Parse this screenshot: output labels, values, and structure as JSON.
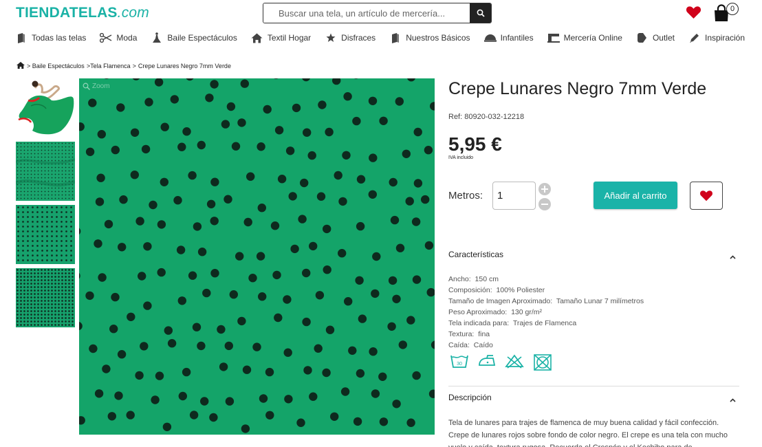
{
  "header": {
    "logo_main": "TIENDATELAS",
    "logo_domain": ".com",
    "search_placeholder": "Buscar una tela, un artículo de mercería...",
    "cart_count": "0"
  },
  "nav": [
    {
      "label": "Todas las telas",
      "icon": "fabric-roll-icon"
    },
    {
      "label": "Moda",
      "icon": "scissors-icon"
    },
    {
      "label": "Baile Espectáculos",
      "icon": "dancer-icon"
    },
    {
      "label": "Textil Hogar",
      "icon": "house-icon"
    },
    {
      "label": "Disfraces",
      "icon": "star-icon"
    },
    {
      "label": "Nuestros Básicos",
      "icon": "fabric-roll-icon"
    },
    {
      "label": "Infantiles",
      "icon": "baby-hat-icon"
    },
    {
      "label": "Mercería Online",
      "icon": "sewing-machine-icon"
    },
    {
      "label": "Outlet",
      "icon": "tag-icon"
    },
    {
      "label": "Inspiración",
      "icon": "pencil-icon"
    }
  ],
  "breadcrumb": {
    "home_icon": "home-icon",
    "items": [
      "> Baile Espectáculos",
      ">Tela Flamenca",
      ">",
      "Crepe Lunares Negro 7mm Verde"
    ]
  },
  "gallery": {
    "zoom_label": "Zoom"
  },
  "product": {
    "title": "Crepe Lunares Negro 7mm Verde",
    "ref": "Ref: 80920-032-12218",
    "price": "5,95 €",
    "iva": "IVA incluido",
    "qty_label": "Metros:",
    "qty_value": "1",
    "add_to_cart": "Añadir al carrito"
  },
  "features": {
    "heading": "Características",
    "rows": [
      {
        "label": "Ancho:",
        "value": "150 cm"
      },
      {
        "label": "Composición:",
        "value": "100% Poliester"
      },
      {
        "label": "Tamaño de Imagen Aproximado:",
        "value": "Tamaño Lunar 7 milímetros"
      },
      {
        "label": "Peso Aproximado:",
        "value": "130 gr/m²"
      },
      {
        "label": "Tela indicada para:",
        "value": "Trajes de Flamenca"
      },
      {
        "label": "Textura:",
        "value": "fina"
      },
      {
        "label": "Caída:",
        "value": "Caído"
      }
    ],
    "wash_temp": "30",
    "care_icons": [
      "wash-30-icon",
      "iron-low-icon",
      "no-bleach-icon",
      "no-tumble-dry-icon"
    ]
  },
  "description": {
    "heading": "Descripción",
    "text": "Tela de lunares para trajes de flamenca de muy buena calidad y fácil confección. Crepe de lunares rojos sobre fondo de color negro. El crepe es una tela con mucho vuelo y caída, textura rugosa. Recuerda el Crespón y el Kechibo para de"
  },
  "colors": {
    "brand": "#1ab2a6",
    "fabric_green": "#14a469",
    "dot": "#0e2a1e",
    "heart": "#d0021b"
  }
}
